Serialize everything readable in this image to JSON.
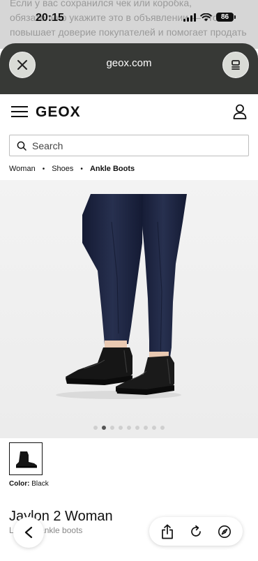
{
  "background_page": {
    "text": "Если у вас сохранился чек или коробка, обязательно укажите это в объявлении — это повышает доверие покупателей и помогает продать дороже."
  },
  "status_bar": {
    "time": "20:15",
    "battery": "86"
  },
  "browser": {
    "url": "geox.com",
    "close_icon": "close-icon",
    "menu_icon": "menu-icon"
  },
  "site": {
    "logo": "GEOX",
    "search_placeholder": "Search"
  },
  "breadcrumb": {
    "items": [
      "Woman",
      "Shoes",
      "Ankle Boots"
    ]
  },
  "gallery": {
    "dot_count": 9,
    "active_index": 1
  },
  "product": {
    "color_label": "Color:",
    "color_value": "Black",
    "title": "Jaylon 2 Woman",
    "subtitle": "Leather ankle boots"
  },
  "colors": {
    "browser_header": "#373936",
    "image_background": "#f0f0f0",
    "trousers": "#1c2340",
    "boots": "#151515"
  }
}
